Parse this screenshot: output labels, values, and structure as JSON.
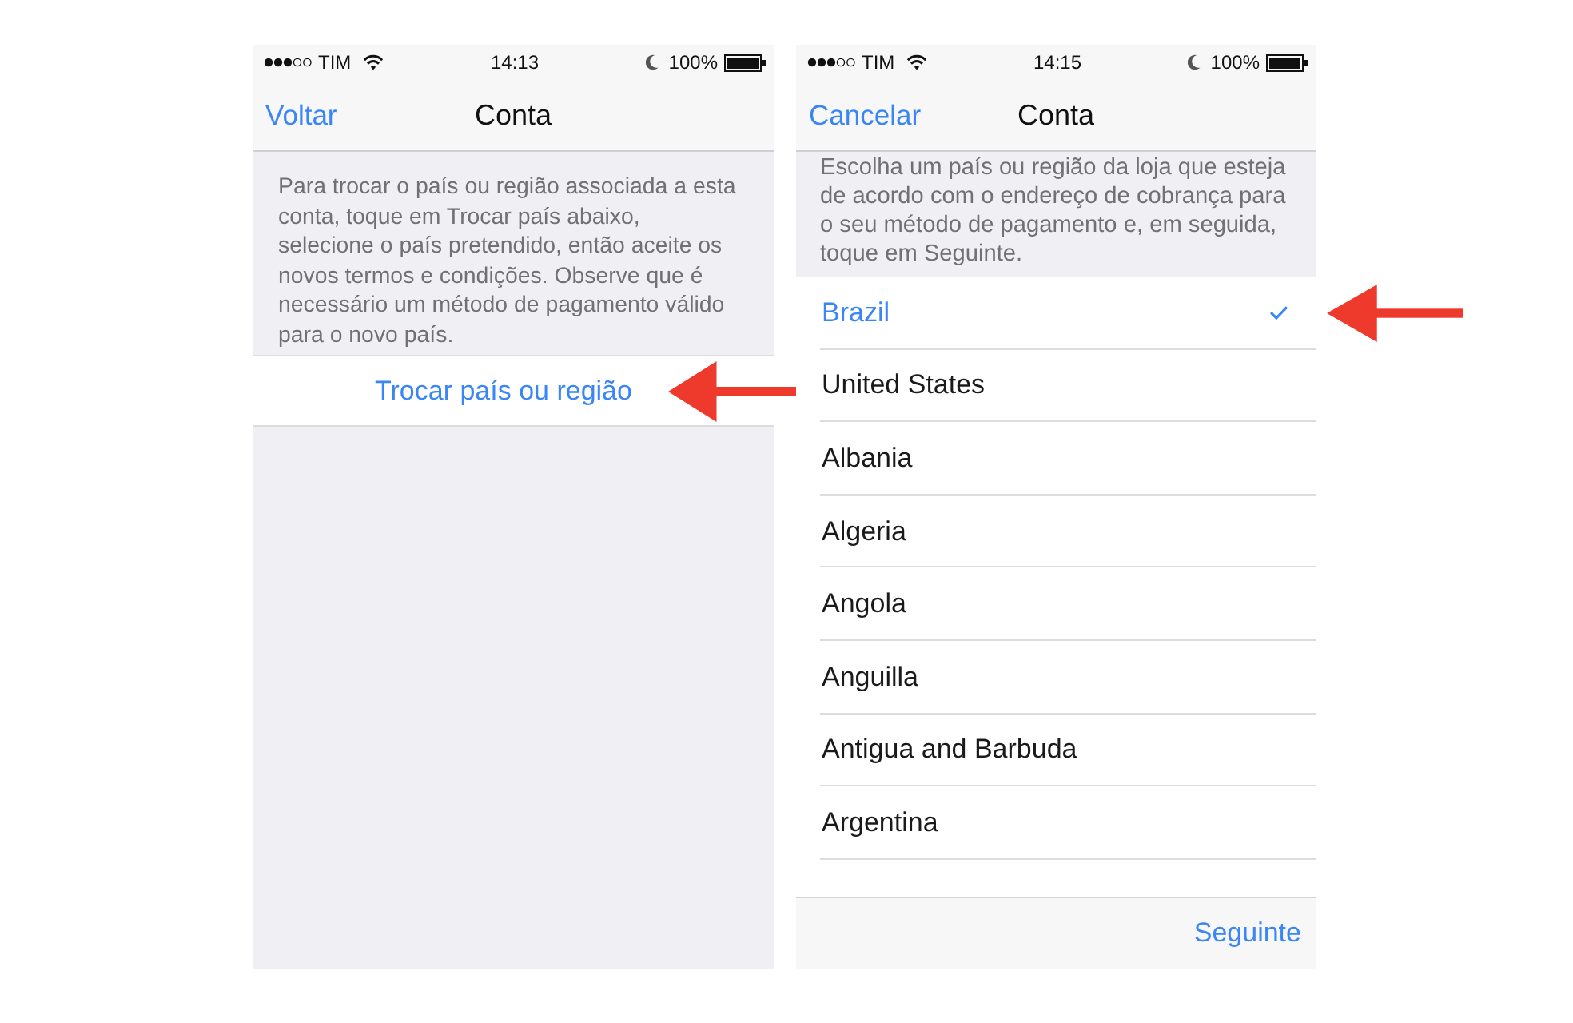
{
  "screens": [
    {
      "kind": "account_info",
      "status_bar": {
        "carrier": "TIM",
        "time": "14:13",
        "do_not_disturb": true,
        "battery": "100%"
      },
      "nav_bar": {
        "back_button": "Voltar",
        "title": "Conta"
      },
      "description": "Para trocar o país ou região associada a esta conta, toque em Trocar país abaixo, selecione o país pretendido, então aceite os novos termos e condições. Observe que é necessário um método de pagamento válido para o novo país.",
      "change_button": {
        "label": "Trocar país ou região",
        "arrow": true
      }
    },
    {
      "kind": "country_picker",
      "status_bar": {
        "carrier": "TIM",
        "time": "14:15",
        "do_not_disturb": true,
        "battery": "100%"
      },
      "nav_bar": {
        "back_button": "Cancelar",
        "title": "Conta"
      },
      "description": "Escolha um país ou região da loja que esteja de acordo com o endereço de cobrança para o seu método de pagamento e, em seguida, toque em Seguinte.",
      "countries": [
        {
          "name": "Brazil",
          "selected": true,
          "arrow": true
        },
        {
          "name": "United States",
          "selected": false,
          "arrow": false
        },
        {
          "name": "Albania",
          "selected": false,
          "arrow": false
        },
        {
          "name": "Algeria",
          "selected": false,
          "arrow": false
        },
        {
          "name": "Angola",
          "selected": false,
          "arrow": false
        },
        {
          "name": "Anguilla",
          "selected": false,
          "arrow": false
        },
        {
          "name": "Antigua and Barbuda",
          "selected": false,
          "arrow": false
        },
        {
          "name": "Argentina",
          "selected": false,
          "arrow": false
        }
      ],
      "toolbar": {
        "next_button": "Seguinte"
      }
    }
  ]
}
